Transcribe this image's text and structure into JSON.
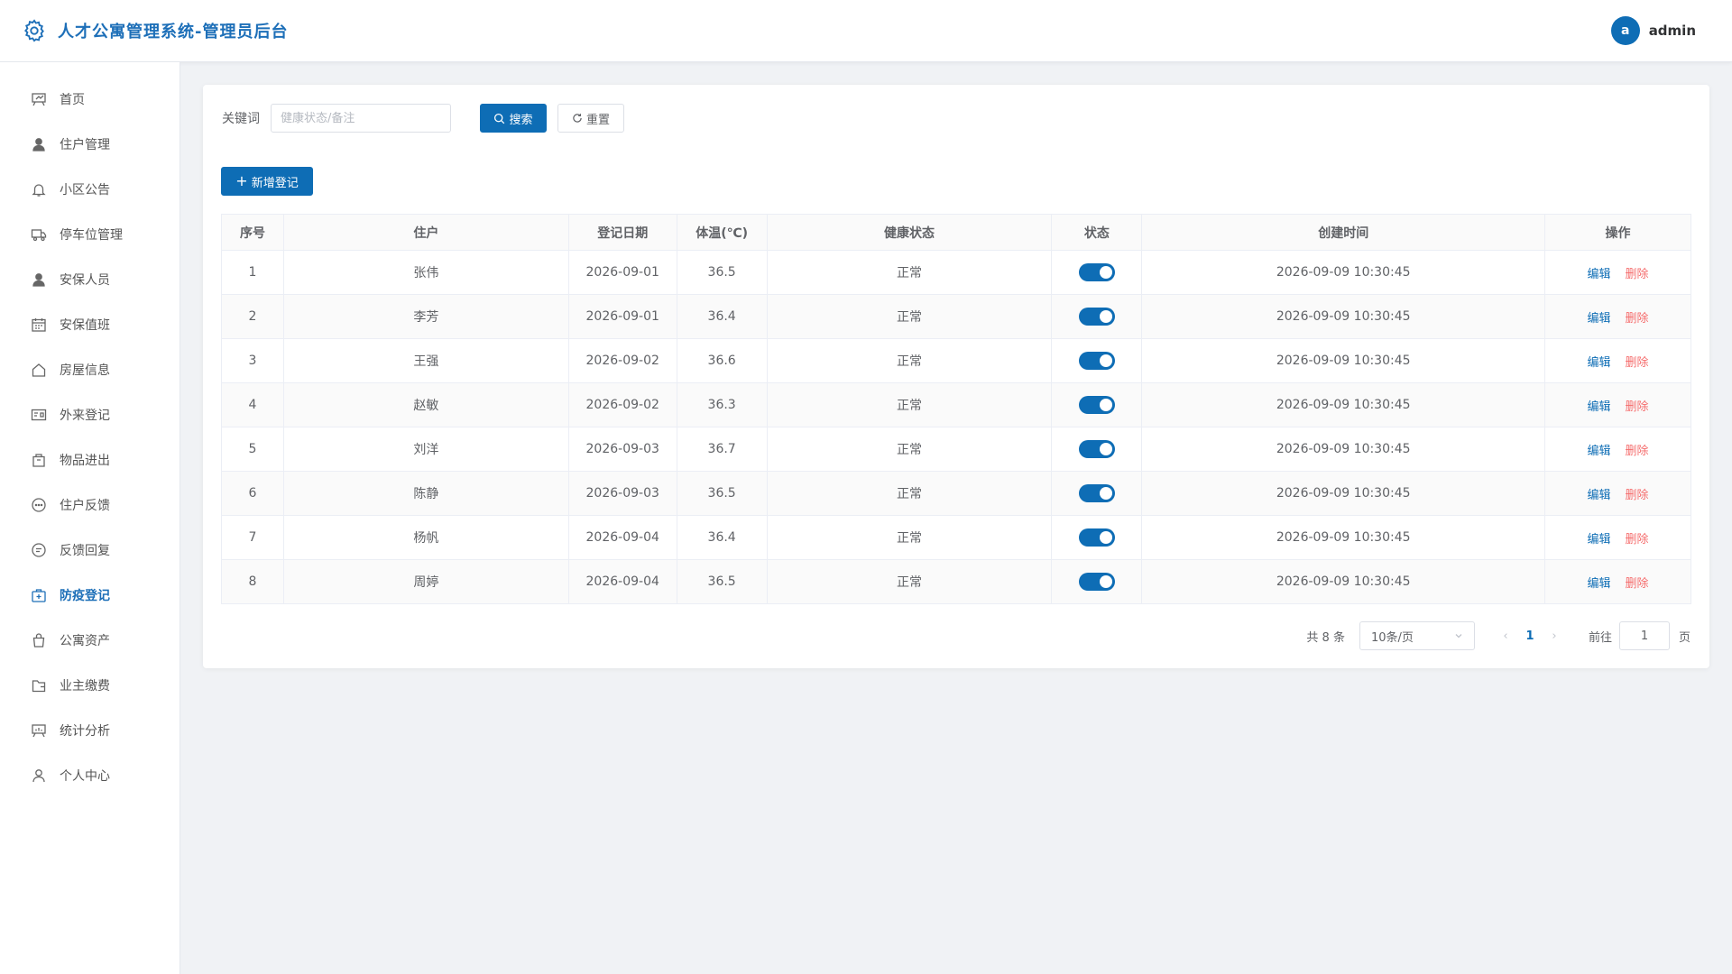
{
  "header": {
    "title": "人才公寓管理系统-管理员后台",
    "avatar_letter": "a",
    "username": "admin",
    "icon": "gear-icon"
  },
  "sidebar": {
    "items": [
      {
        "label": "首页",
        "icon": "presentation-icon",
        "active": false
      },
      {
        "label": "住户管理",
        "icon": "user-icon",
        "active": false
      },
      {
        "label": "小区公告",
        "icon": "bell-icon",
        "active": false
      },
      {
        "label": "停车位管理",
        "icon": "truck-icon",
        "active": false
      },
      {
        "label": "安保人员",
        "icon": "user-icon",
        "active": false
      },
      {
        "label": "安保值班",
        "icon": "calendar-icon",
        "active": false
      },
      {
        "label": "房屋信息",
        "icon": "house-icon",
        "active": false
      },
      {
        "label": "外来登记",
        "icon": "id-card-icon",
        "active": false
      },
      {
        "label": "物品进出",
        "icon": "box-icon",
        "active": false
      },
      {
        "label": "住户反馈",
        "icon": "chat-dots-icon",
        "active": false
      },
      {
        "label": "反馈回复",
        "icon": "chat-lines-icon",
        "active": false
      },
      {
        "label": "防疫登记",
        "icon": "first-aid-icon",
        "active": true
      },
      {
        "label": "公寓资产",
        "icon": "bag-icon",
        "active": false
      },
      {
        "label": "业主缴费",
        "icon": "wallet-icon",
        "active": false
      },
      {
        "label": "统计分析",
        "icon": "chart-board-icon",
        "active": false
      },
      {
        "label": "个人中心",
        "icon": "person-outline-icon",
        "active": false
      }
    ]
  },
  "search": {
    "label": "关键词",
    "placeholder": "健康状态/备注",
    "value": "",
    "search_label": "搜索",
    "reset_label": "重置"
  },
  "toolbar": {
    "add_label": "新增登记"
  },
  "table": {
    "headers": [
      "序号",
      "住户",
      "登记日期",
      "体温(℃)",
      "健康状态",
      "状态",
      "创建时间",
      "操作"
    ],
    "rows": [
      {
        "no": "1",
        "name": "张伟",
        "date": "2026-09-01",
        "temp": "36.5",
        "health": "正常",
        "enabled": true,
        "created": "2026-09-09 10:30:45"
      },
      {
        "no": "2",
        "name": "李芳",
        "date": "2026-09-01",
        "temp": "36.4",
        "health": "正常",
        "enabled": true,
        "created": "2026-09-09 10:30:45"
      },
      {
        "no": "3",
        "name": "王强",
        "date": "2026-09-02",
        "temp": "36.6",
        "health": "正常",
        "enabled": true,
        "created": "2026-09-09 10:30:45"
      },
      {
        "no": "4",
        "name": "赵敏",
        "date": "2026-09-02",
        "temp": "36.3",
        "health": "正常",
        "enabled": true,
        "created": "2026-09-09 10:30:45"
      },
      {
        "no": "5",
        "name": "刘洋",
        "date": "2026-09-03",
        "temp": "36.7",
        "health": "正常",
        "enabled": true,
        "created": "2026-09-09 10:30:45"
      },
      {
        "no": "6",
        "name": "陈静",
        "date": "2026-09-03",
        "temp": "36.5",
        "health": "正常",
        "enabled": true,
        "created": "2026-09-09 10:30:45"
      },
      {
        "no": "7",
        "name": "杨帆",
        "date": "2026-09-04",
        "temp": "36.4",
        "health": "正常",
        "enabled": true,
        "created": "2026-09-09 10:30:45"
      },
      {
        "no": "8",
        "name": "周婷",
        "date": "2026-09-04",
        "temp": "36.5",
        "health": "正常",
        "enabled": true,
        "created": "2026-09-09 10:30:45"
      }
    ],
    "edit_label": "编辑",
    "delete_label": "删除"
  },
  "pagination": {
    "total_text": "共 8 条",
    "page_size": "10条/页",
    "current_page": "1",
    "goto_label": "前往",
    "goto_value": "1",
    "page_suffix": "页"
  },
  "colors": {
    "primary": "#0e6db5",
    "danger": "#f56c6c",
    "title": "#1d6fb8"
  }
}
